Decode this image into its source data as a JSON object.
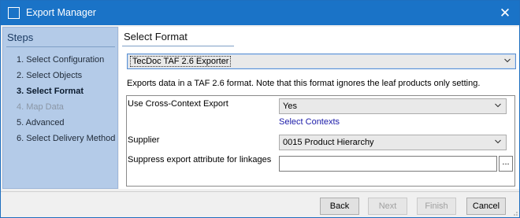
{
  "window": {
    "title": "Export Manager",
    "icon": "window-app-icon",
    "close_symbol": "✕",
    "accent_color": "#1a73c7"
  },
  "sidebar": {
    "heading": "Steps",
    "background": "#b4cbe8",
    "steps": [
      {
        "label": "1. Select Configuration",
        "state": "normal"
      },
      {
        "label": "2. Select Objects",
        "state": "normal"
      },
      {
        "label": "3. Select Format",
        "state": "active"
      },
      {
        "label": "4. Map Data",
        "state": "disabled"
      },
      {
        "label": "5. Advanced",
        "state": "normal"
      },
      {
        "label": "6. Select Delivery Method",
        "state": "normal"
      }
    ]
  },
  "main": {
    "heading": "Select Format",
    "format_select": {
      "value": "TecDoc TAF 2.6 Exporter",
      "icon": "chevron-down-icon"
    },
    "description": "Exports data in a TAF 2.6 format. Note that this format ignores the leaf products only setting.",
    "fields": {
      "cross_context": {
        "label": "Use Cross-Context Export",
        "value": "Yes",
        "link": "Select Contexts"
      },
      "supplier": {
        "label": "Supplier",
        "value": "0015 Product Hierarchy"
      },
      "suppress_attr": {
        "label": "Suppress export attribute for linkages",
        "value": "",
        "browse_label": "..."
      }
    }
  },
  "footer": {
    "back_label": "Back",
    "next_label": "Next",
    "finish_label": "Finish",
    "cancel_label": "Cancel"
  }
}
